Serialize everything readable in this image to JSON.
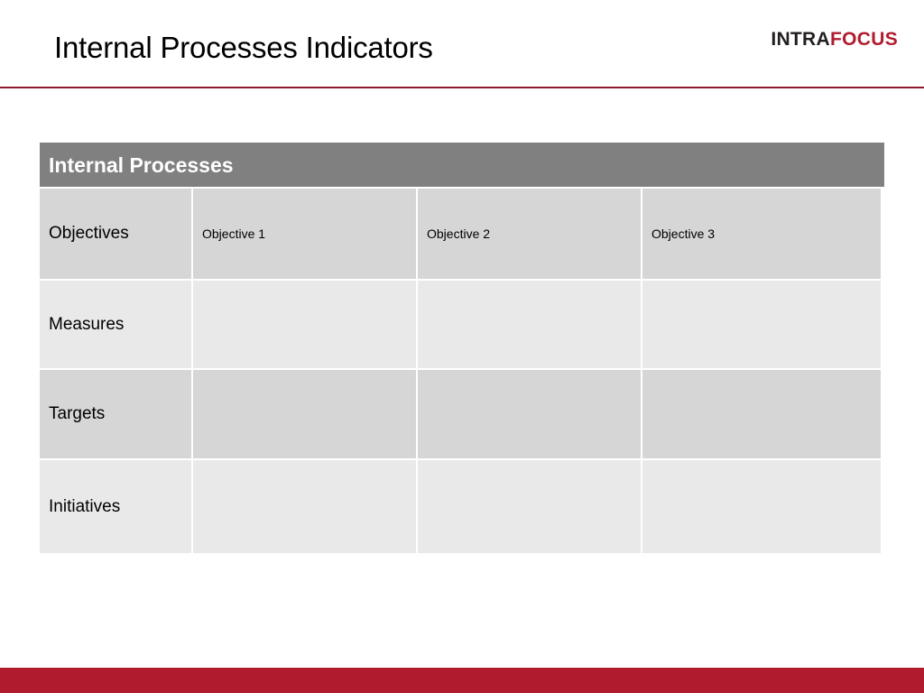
{
  "header": {
    "title": "Internal Processes Indicators",
    "logo": {
      "part_one": "INTRA",
      "part_two": "FOCUS",
      "part_one_color": "#231f20",
      "part_two_color": "#b01c2e"
    },
    "rule_color": "#8c1a2b"
  },
  "table": {
    "band_label": "Internal Processes",
    "band_color": "#808080",
    "band_text_color": "#ffffff",
    "row_color_dark": "#d6d6d6",
    "row_color_light": "#e9e9e9",
    "column_headers": [
      "",
      "",
      "",
      ""
    ],
    "rows": [
      {
        "label": "Objectives",
        "shade": "dark",
        "cells": [
          "Objective 1",
          "Objective 2",
          "Objective 3"
        ]
      },
      {
        "label": "Measures",
        "shade": "light",
        "cells": [
          "",
          "",
          ""
        ]
      },
      {
        "label": "Targets",
        "shade": "dark",
        "cells": [
          "",
          "",
          ""
        ]
      },
      {
        "label": "Initiatives",
        "shade": "light",
        "cells": [
          "",
          "",
          ""
        ]
      }
    ]
  },
  "footer": {
    "bar_color": "#b01c2e"
  }
}
